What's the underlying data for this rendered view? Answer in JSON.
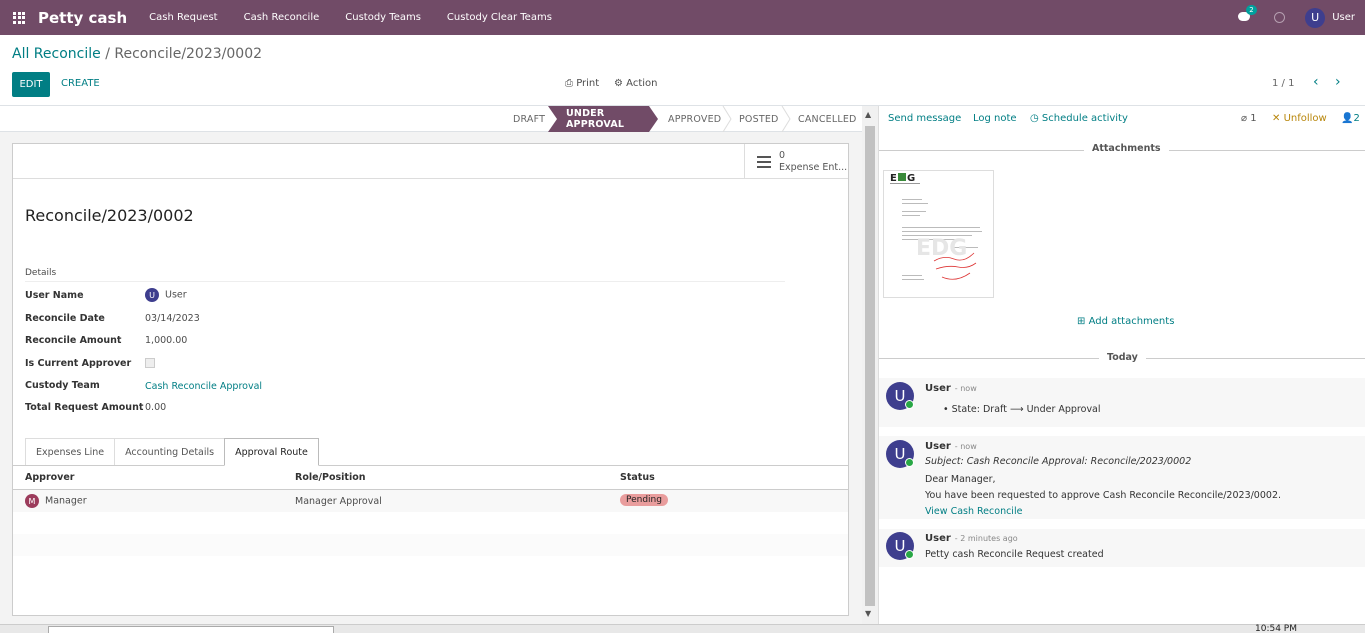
{
  "nav": {
    "brand": "Petty cash",
    "items": [
      "Cash Request",
      "Cash Reconcile",
      "Custody Teams",
      "Custody Clear Teams"
    ],
    "message_count": "2",
    "user_initial": "U",
    "user_name": "User"
  },
  "breadcrumb": {
    "parent": "All Reconcile",
    "separator": "/",
    "current": "Reconcile/2023/0002"
  },
  "toolbar": {
    "edit": "EDIT",
    "create": "CREATE",
    "print": "Print",
    "action": "Action",
    "pager": "1 / 1"
  },
  "status": {
    "stages": [
      "DRAFT",
      "UNDER APPROVAL",
      "APPROVED",
      "POSTED",
      "CANCELLED"
    ],
    "active": "UNDER APPROVAL"
  },
  "smart_button": {
    "count": "0",
    "label": "Expense Ent..."
  },
  "record": {
    "title": "Reconcile/2023/0002",
    "group": "Details",
    "fields": [
      {
        "label": "User Name",
        "value": "User"
      },
      {
        "label": "Reconcile Date",
        "value": "03/14/2023"
      },
      {
        "label": "Reconcile Amount",
        "value": "1,000.00"
      },
      {
        "label": "Is Current Approver",
        "value": ""
      },
      {
        "label": "Custody Team",
        "value": "Cash Reconcile Approval"
      },
      {
        "label": "Total Request Amount",
        "value": "0.00"
      }
    ]
  },
  "tabs": [
    "Expenses Line",
    "Accounting Details",
    "Approval Route"
  ],
  "approval": {
    "headers": [
      "Approver",
      "Role/Position",
      "Status"
    ],
    "rows": [
      {
        "initial": "M",
        "approver": "Manager",
        "role": "Manager Approval",
        "status": "Pending"
      }
    ]
  },
  "chatter": {
    "send_message": "Send message",
    "log_note": "Log note",
    "schedule": "Schedule activity",
    "attach_count": "1",
    "unfollow": "Unfollow",
    "followers": "2",
    "attachments_title": "Attachments",
    "add_attachments": "Add attachments",
    "today": "Today",
    "messages": [
      {
        "author": "User",
        "time": "- now",
        "lines": [
          "State: Draft ⟶ Under Approval"
        ]
      },
      {
        "author": "User",
        "time": "- now",
        "subject": "Subject: Cash Reconcile Approval: Reconcile/2023/0002",
        "lines": [
          "Dear Manager,",
          "You have been requested to approve Cash Reconcile Reconcile/2023/0002."
        ],
        "link": "View Cash Reconcile"
      },
      {
        "author": "User",
        "time": "- 2 minutes ago",
        "lines": [
          "Petty cash Reconcile Request created"
        ]
      }
    ]
  },
  "taskbar": {
    "time": "10:54 PM"
  },
  "colors": {
    "brand": "#714b67",
    "accent": "#017e84",
    "pending": "#e99d9d"
  }
}
